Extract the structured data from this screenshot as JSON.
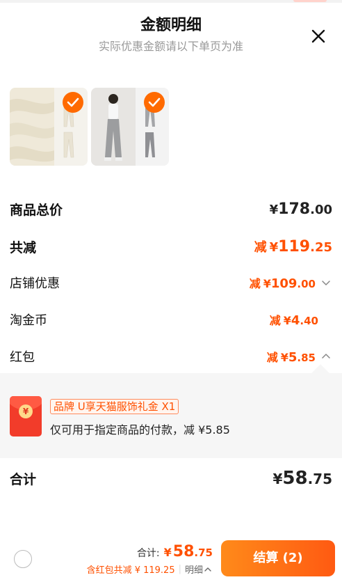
{
  "header": {
    "title": "金额明细",
    "subtitle": "实际优惠金额请以下单页为准"
  },
  "icons": {
    "close": "close-icon",
    "check": "check-icon",
    "chevron_down": "chevron-down-icon",
    "chevron_up": "chevron-up-icon",
    "red_packet": "red-packet-icon"
  },
  "colors": {
    "accent": "#ff5000",
    "check_bg": "#ff6a00",
    "button_start": "#ff8a1a",
    "button_end": "#ff5a12",
    "red_packet": "#f23c2a"
  },
  "summary": {
    "total_label": "商品总价",
    "total_symbol": "¥",
    "total_int": "178",
    "total_dec": ".00",
    "discount_label": "共减",
    "discount_prefix": "减",
    "discount_symbol": "¥",
    "discount_int": "119",
    "discount_dec": ".25"
  },
  "discounts": [
    {
      "label": "店铺优惠",
      "prefix": "减",
      "symbol": "¥",
      "int": "109",
      "dec": ".00",
      "chevron": "down"
    },
    {
      "label": "淘金币",
      "prefix": "减",
      "symbol": "¥",
      "int": "4",
      "dec": ".40",
      "chevron": ""
    },
    {
      "label": "红包",
      "prefix": "减",
      "symbol": "¥",
      "int": "5",
      "dec": ".85",
      "chevron": "up"
    }
  ],
  "coupon": {
    "coin_glyph": "¥",
    "tag": "品牌 U享天猫服饰礼金 X1",
    "description": "仅可用于指定商品的付款，减 ¥5.85"
  },
  "grand_total": {
    "label": "合计",
    "symbol": "¥",
    "int": "58",
    "dec": ".75"
  },
  "footer": {
    "sum_label": "合计:",
    "sum_symbol": "¥",
    "sum_int": "58",
    "sum_dec": ".75",
    "sub_text": "含红包共减 ¥ 119.25",
    "separator": "|",
    "detail_label": "明细",
    "checkout_label": "结算 (2)"
  }
}
